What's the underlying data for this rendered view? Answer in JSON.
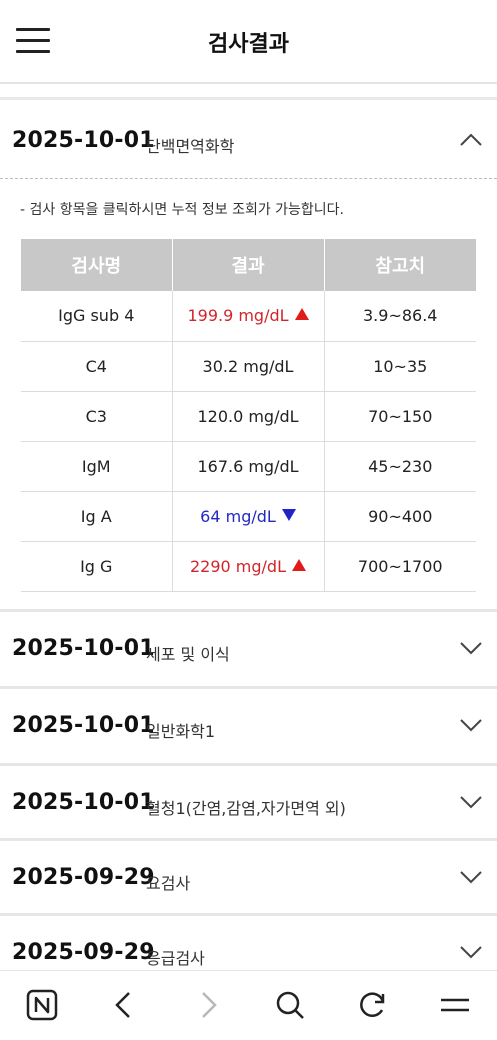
{
  "header": {
    "title": "검사결과"
  },
  "sections": [
    {
      "date": "2025-10-01",
      "category": "단백면역화학",
      "expanded": true,
      "hint": "- 검사 항목을 클릭하시면 누적 정보 조회가 가능합니다.",
      "table": {
        "headers": [
          "검사명",
          "결과",
          "참고치"
        ],
        "rows": [
          {
            "name": "IgG sub 4",
            "result": "199.9 mg/dL",
            "flag": "high",
            "reference": "3.9~86.4"
          },
          {
            "name": "C4",
            "result": "30.2 mg/dL",
            "flag": "none",
            "reference": "10~35"
          },
          {
            "name": "C3",
            "result": "120.0 mg/dL",
            "flag": "none",
            "reference": "70~150"
          },
          {
            "name": "IgM",
            "result": "167.6 mg/dL",
            "flag": "none",
            "reference": "45~230"
          },
          {
            "name": "Ig A",
            "result": "64 mg/dL",
            "flag": "low",
            "reference": "90~400"
          },
          {
            "name": "Ig G",
            "result": "2290 mg/dL",
            "flag": "high",
            "reference": "700~1700"
          }
        ]
      }
    },
    {
      "date": "2025-10-01",
      "category": "세포 및 이식",
      "expanded": false
    },
    {
      "date": "2025-10-01",
      "category": "일반화학1",
      "expanded": false
    },
    {
      "date": "2025-10-01",
      "category": "혈청1(간염,감염,자가면역 외)",
      "expanded": false
    },
    {
      "date": "2025-09-29",
      "category": "요검사",
      "expanded": false
    },
    {
      "date": "2025-09-29",
      "category": "응급검사",
      "expanded": false
    }
  ],
  "bottom_nav": {
    "icons": [
      "naver-n-icon",
      "back-icon",
      "forward-icon",
      "search-icon",
      "refresh-icon",
      "menu-icon"
    ]
  },
  "colors": {
    "high_text": "#d0262b",
    "high_flag": "#e11a1a",
    "low_text": "#2329c2",
    "low_flag": "#1f23c8",
    "table_header_bg": "#c8c8c8"
  }
}
